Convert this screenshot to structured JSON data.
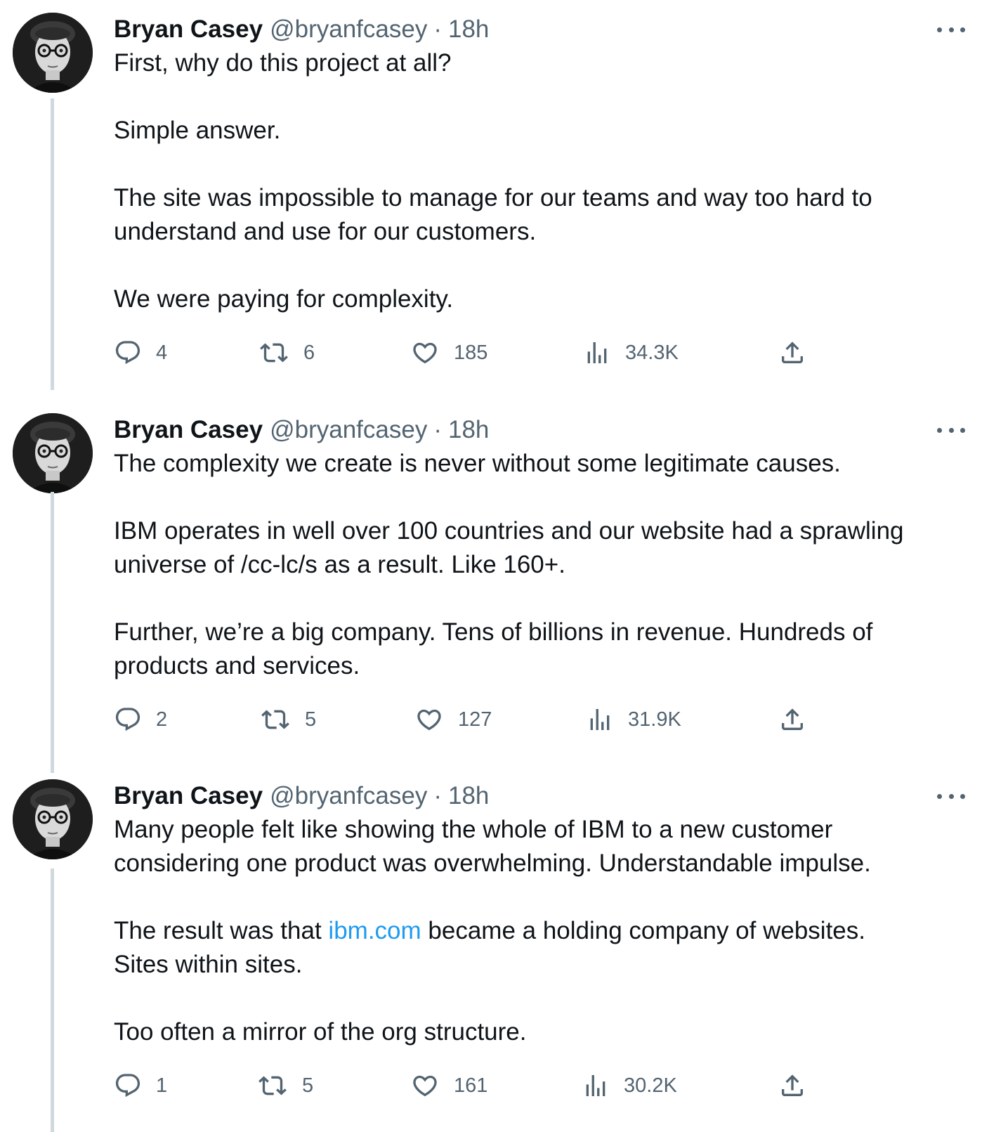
{
  "tweets": [
    {
      "name": "Bryan Casey",
      "handle": "@bryanfcasey",
      "separator": "·",
      "time": "18h",
      "paragraphs": [
        [
          "First, why do this project at all?"
        ],
        [
          "Simple answer."
        ],
        [
          "The site was impossible to manage for our teams and way too hard to",
          "understand and use for our customers."
        ],
        [
          "We were paying for complexity."
        ]
      ],
      "stats": {
        "replies": "4",
        "retweets": "6",
        "likes": "185",
        "views": "34.3K"
      }
    },
    {
      "name": "Bryan Casey",
      "handle": "@bryanfcasey",
      "separator": "·",
      "time": "18h",
      "paragraphs": [
        [
          "The complexity we create is never without some legitimate causes."
        ],
        [
          "IBM operates in well over 100 countries and our website had a sprawling",
          "universe of /cc-lc/s as a result. Like 160+."
        ],
        [
          "Further, we’re a big company. Tens of billions in revenue. Hundreds of",
          "products and services."
        ]
      ],
      "stats": {
        "replies": "2",
        "retweets": "5",
        "likes": "127",
        "views": "31.9K"
      }
    },
    {
      "name": "Bryan Casey",
      "handle": "@bryanfcasey",
      "separator": "·",
      "time": "18h",
      "paragraphs": [
        [
          "Many people felt like showing the whole of IBM to a new customer",
          "considering one product was overwhelming. Understandable impulse."
        ],
        [
          "The result was that ",
          "Sites within sites."
        ],
        [
          "Too often a mirror of the org structure."
        ]
      ],
      "link_line": {
        "before": "The result was that ",
        "link": "ibm.com",
        "after": " became a holding company of websites."
      },
      "stats": {
        "replies": "1",
        "retweets": "5",
        "likes": "161",
        "views": "30.2K"
      }
    }
  ],
  "icons": {
    "reply": "reply-icon",
    "retweet": "retweet-icon",
    "like": "heart-icon",
    "views": "views-chart-icon",
    "share": "share-icon",
    "more": "more-dots-icon"
  },
  "colors": {
    "text": "#0f1419",
    "secondary": "#536471",
    "link": "#1d9bf0",
    "thread_line": "#cfd9de"
  }
}
